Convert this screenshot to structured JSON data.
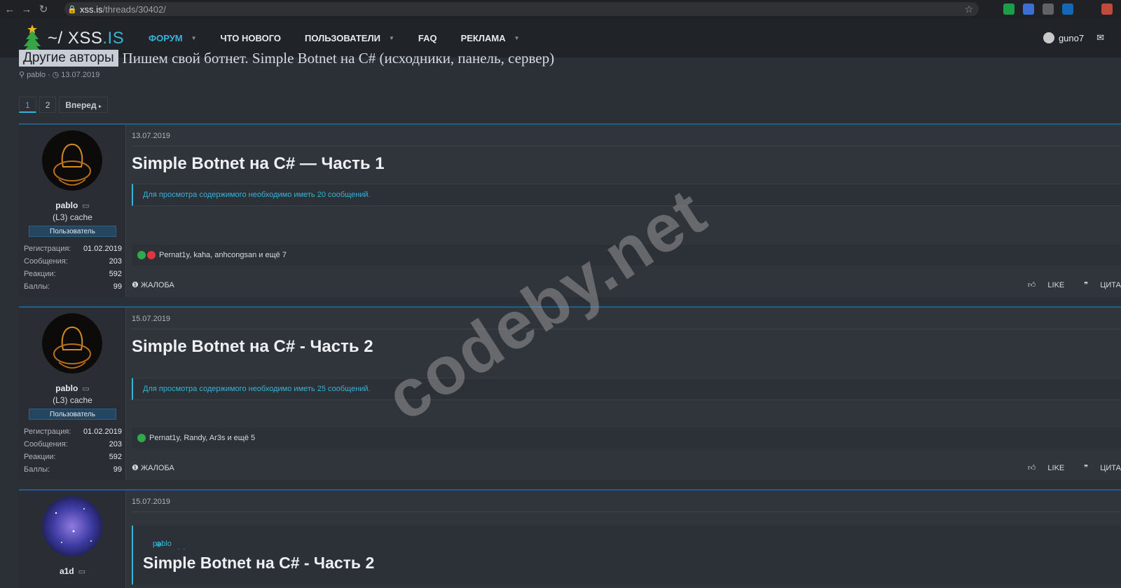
{
  "browser": {
    "url_domain": "xss.is",
    "url_path": "/threads/30402/"
  },
  "header": {
    "logo_prefix": "~/ XSS",
    "logo_suffix": ".IS",
    "nav": [
      {
        "label": "ФОРУМ"
      },
      {
        "label": "ЧТО НОВОГО"
      },
      {
        "label": "ПОЛЬЗОВАТЕЛИ"
      },
      {
        "label": "FAQ"
      },
      {
        "label": "РЕКЛАМА"
      }
    ],
    "username": "guno7"
  },
  "thread": {
    "prefix": "Другие авторы",
    "title": "Пишем свой ботнет. Simple Botnet на C# (исходники, панель, сервер)",
    "author": "pablo",
    "date": "13.07.2019",
    "separator": "·"
  },
  "pagination": {
    "pages": [
      "1",
      "2"
    ],
    "next": "Вперед"
  },
  "posts": [
    {
      "author": "pablo",
      "user_title": "(L3) cache",
      "banner": "Пользователь",
      "stats": [
        {
          "k": "Регистрация:",
          "v": "01.02.2019"
        },
        {
          "k": "Сообщения:",
          "v": "203"
        },
        {
          "k": "Реакции:",
          "v": "592"
        },
        {
          "k": "Баллы:",
          "v": "99"
        }
      ],
      "date": "13.07.2019",
      "title": "Simple Botnet на C# — Часть 1",
      "notice": "Для просмотра содержимого необходимо иметь 20 сообщений.",
      "reactions": "Pernat1y, kaha, anhcongsan и ещё 7",
      "report": "Жалоба",
      "like": "Like",
      "quote": "Цита"
    },
    {
      "author": "pablo",
      "user_title": "(L3) cache",
      "banner": "Пользователь",
      "stats": [
        {
          "k": "Регистрация:",
          "v": "01.02.2019"
        },
        {
          "k": "Сообщения:",
          "v": "203"
        },
        {
          "k": "Реакции:",
          "v": "592"
        },
        {
          "k": "Баллы:",
          "v": "99"
        }
      ],
      "date": "15.07.2019",
      "title": "Simple Botnet на C# - Часть 2",
      "notice": "Для просмотра содержимого необходимо иметь 25 сообщений.",
      "reactions": "Pernat1y, Randy, Ar3s и ещё 5",
      "report": "Жалоба",
      "like": "Like",
      "quote": "Цита"
    },
    {
      "author": "a1d",
      "date": "15.07.2019",
      "quote_attr": "pablo сказал(а):",
      "quote_title": "Simple Botnet на C# - Часть 2"
    }
  ],
  "watermark": "codeby.net",
  "colors": {
    "accent": "#36b3d8",
    "background": "#2b2f36",
    "header": "#202429",
    "post_border": "#1f5f8a"
  }
}
